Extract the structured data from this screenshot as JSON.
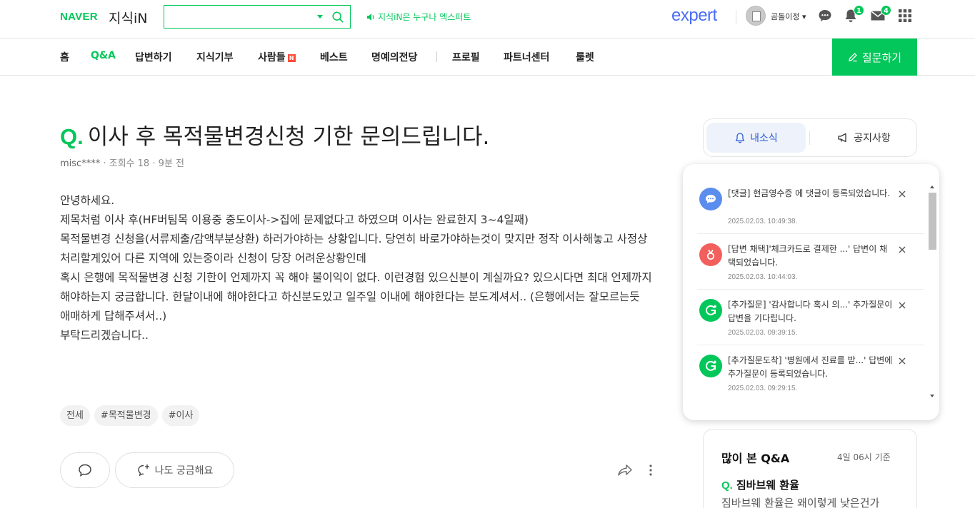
{
  "header": {
    "logo_naver": "NAVER",
    "logo_jisik": "지식iN",
    "search_placeholder": "",
    "notice": "지식iN은 누구나 엑스퍼트",
    "expert_logo": "expert",
    "username": "곰돌이정",
    "notification_count": "1",
    "message_count": "4"
  },
  "nav": {
    "items": [
      "홈",
      "Q&A",
      "답변하기",
      "지식기부",
      "사람들",
      "베스트",
      "명예의전당",
      "프로필",
      "파트너센터",
      "룰렛"
    ],
    "new_badge": "N",
    "ask_button": "질문하기"
  },
  "question": {
    "q_mark": "Q.",
    "title": "이사 후 목적물변경신청 기한 문의드립니다.",
    "author": "misc****",
    "views": "조회수 18",
    "time": "9분 전",
    "body": [
      "안녕하세요.",
      "제목처럼 이사 후(HF버팀목 이용중 중도이사->집에 문제없다고 하였으며 이사는 완료한지 3~4일째)",
      "",
      "목적물변경 신청을(서류제출/감액부분상환) 하러가야하는 상황입니다. 당연히 바로가야하는것이 맞지만 정작 이사해놓고 사정상 처리할게있어 다른 지역에 있는중이라 신청이 당장 어려운상황인데",
      "",
      "혹시 은행에 목적물변경 신청 기한이 언제까지 꼭 해야 불이익이 없다. 이런경험 있으신분이 계실까요? 있으시다면 최대 언제까지 해야하는지 궁금합니다. 한달이내에 해야한다고 하신분도있고 일주일 이내에 해야한다는 분도계셔서.. (은행에서는 잘모르는듯 애매하게 답해주셔서..)",
      "부탁드리겠습니다.."
    ],
    "tags": [
      "전세",
      "#목적물변경",
      "#이사"
    ],
    "curious_label": "나도 궁금해요"
  },
  "side_tabs": {
    "mynews": "내소식",
    "notice": "공지사항"
  },
  "notifications": [
    {
      "icon": "comment-bubble-icon",
      "color": "#5b8def",
      "text": "[댓글] 현금영수증 에 댓글이 등록되었습니다.",
      "time": "2025.02.03. 10:49:38."
    },
    {
      "icon": "adopt-icon",
      "color": "#f25f5c",
      "text": "[답변 채택]'체크카드로 결제한 ...' 답변이 채택되었습니다.",
      "time": "2025.02.03. 10:44:03."
    },
    {
      "icon": "additional-question-icon",
      "color": "#03c75a",
      "text": "[추가질문] '감사합니다 혹시 의...' 추가질문이 답변을 기다립니다.",
      "time": "2025.02.03. 09:39:15."
    },
    {
      "icon": "additional-question-icon",
      "color": "#03c75a",
      "text": "[추가질문도착] '병원에서 진료를 받...' 답변에 추가질문이 등록되었습니다.",
      "time": "2025.02.03. 09:29:15."
    }
  ],
  "popular": {
    "title": "많이 본 Q&A",
    "time": "4일 06시 기준",
    "q_mark": "Q.",
    "question": "짐바브웨 환율",
    "snippet": "짐바브웨 환율은 왜이렇게 낮은건가"
  },
  "colors": {
    "brand_green": "#03c75a",
    "expert_blue": "#4a6cf7"
  }
}
